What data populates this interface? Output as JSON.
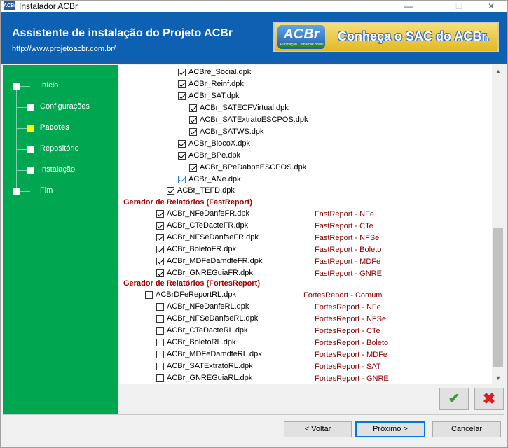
{
  "window": {
    "title": "Instalador ACBr",
    "minimize": "—",
    "maximize": "☐",
    "close": "✕"
  },
  "header": {
    "title": "Assistente de instalação do Projeto ACBr",
    "link": "http://www.projetoacbr.com.br/",
    "banner_logo": "ACBr",
    "banner_logo_sub": "Automação Comercial Brasil",
    "banner_text": "Conheça o SAC do ACBr."
  },
  "sidebar": {
    "steps": [
      {
        "label": "Início"
      },
      {
        "label": "Configurações"
      },
      {
        "label": "Pacotes"
      },
      {
        "label": "Repositório"
      },
      {
        "label": "Instalação"
      },
      {
        "label": "Fim"
      }
    ]
  },
  "packages": {
    "rows1": [
      {
        "label": "ACBre_Social.dpk",
        "checked": true
      },
      {
        "label": "ACBr_Reinf.dpk",
        "checked": true
      },
      {
        "label": "ACBr_SAT.dpk",
        "checked": true
      },
      {
        "label": "ACBr_SATECFVirtual.dpk",
        "checked": true
      },
      {
        "label": "ACBr_SATExtratoESCPOS.dpk",
        "checked": true
      },
      {
        "label": "ACBr_SATWS.dpk",
        "checked": true
      },
      {
        "label": "ACBr_BlocoX.dpk",
        "checked": true
      },
      {
        "label": "ACBr_BPe.dpk",
        "checked": true
      },
      {
        "label": "ACBr_BPeDabpeESCPOS.dpk",
        "checked": true
      },
      {
        "label": "ACBr_ANe.dpk",
        "checked": true
      },
      {
        "label": "ACBr_TEFD.dpk",
        "checked": true
      }
    ],
    "section_fast": "Gerador de Relatórios (FastReport)",
    "rows_fast": [
      {
        "label": "ACBr_NFeDanfeFR.dpk",
        "desc": "FastReport - NFe",
        "checked": true
      },
      {
        "label": "ACBr_CTeDacteFR.dpk",
        "desc": "FastReport - CTe",
        "checked": true
      },
      {
        "label": "ACBr_NFSeDanfseFR.dpk",
        "desc": "FastReport - NFSe",
        "checked": true
      },
      {
        "label": "ACBr_BoletoFR.dpk",
        "desc": "FastReport - Boleto",
        "checked": true
      },
      {
        "label": "ACBr_MDFeDamdfeFR.dpk",
        "desc": "FastReport - MDFe",
        "checked": true
      },
      {
        "label": "ACBr_GNREGuiaFR.dpk",
        "desc": "FastReport - GNRE",
        "checked": true
      }
    ],
    "section_fortes": "Gerador de Relatórios (FortesReport)",
    "fortes_parent": {
      "label": "ACBrDFeReportRL.dpk",
      "desc": "FortesReport - Comum",
      "checked": false
    },
    "rows_fortes": [
      {
        "label": "ACBr_NFeDanfeRL.dpk",
        "desc": "FortesReport - NFe",
        "checked": false
      },
      {
        "label": "ACBr_NFSeDanfseRL.dpk",
        "desc": "FortesReport - NFSe",
        "checked": false
      },
      {
        "label": "ACBr_CTeDacteRL.dpk",
        "desc": "FortesReport - CTe",
        "checked": false
      },
      {
        "label": "ACBr_BoletoRL.dpk",
        "desc": "FortesReport - Boleto",
        "checked": false
      },
      {
        "label": "ACBr_MDFeDamdfeRL.dpk",
        "desc": "FortesReport - MDFe",
        "checked": false
      },
      {
        "label": "ACBr_SATExtratoRL.dpk",
        "desc": "FortesReport - SAT",
        "checked": false
      },
      {
        "label": "ACBr_GNREGuiaRL.dpk",
        "desc": "FortesReport - GNRE",
        "checked": false
      }
    ]
  },
  "scrollbar": {
    "up": "▲",
    "down": "▼"
  },
  "actions": {
    "ok_glyph": "✔",
    "cancel_glyph": "✖"
  },
  "buttons": {
    "back": "< Voltar",
    "next": "Próximo >",
    "cancel": "Cancelar"
  }
}
